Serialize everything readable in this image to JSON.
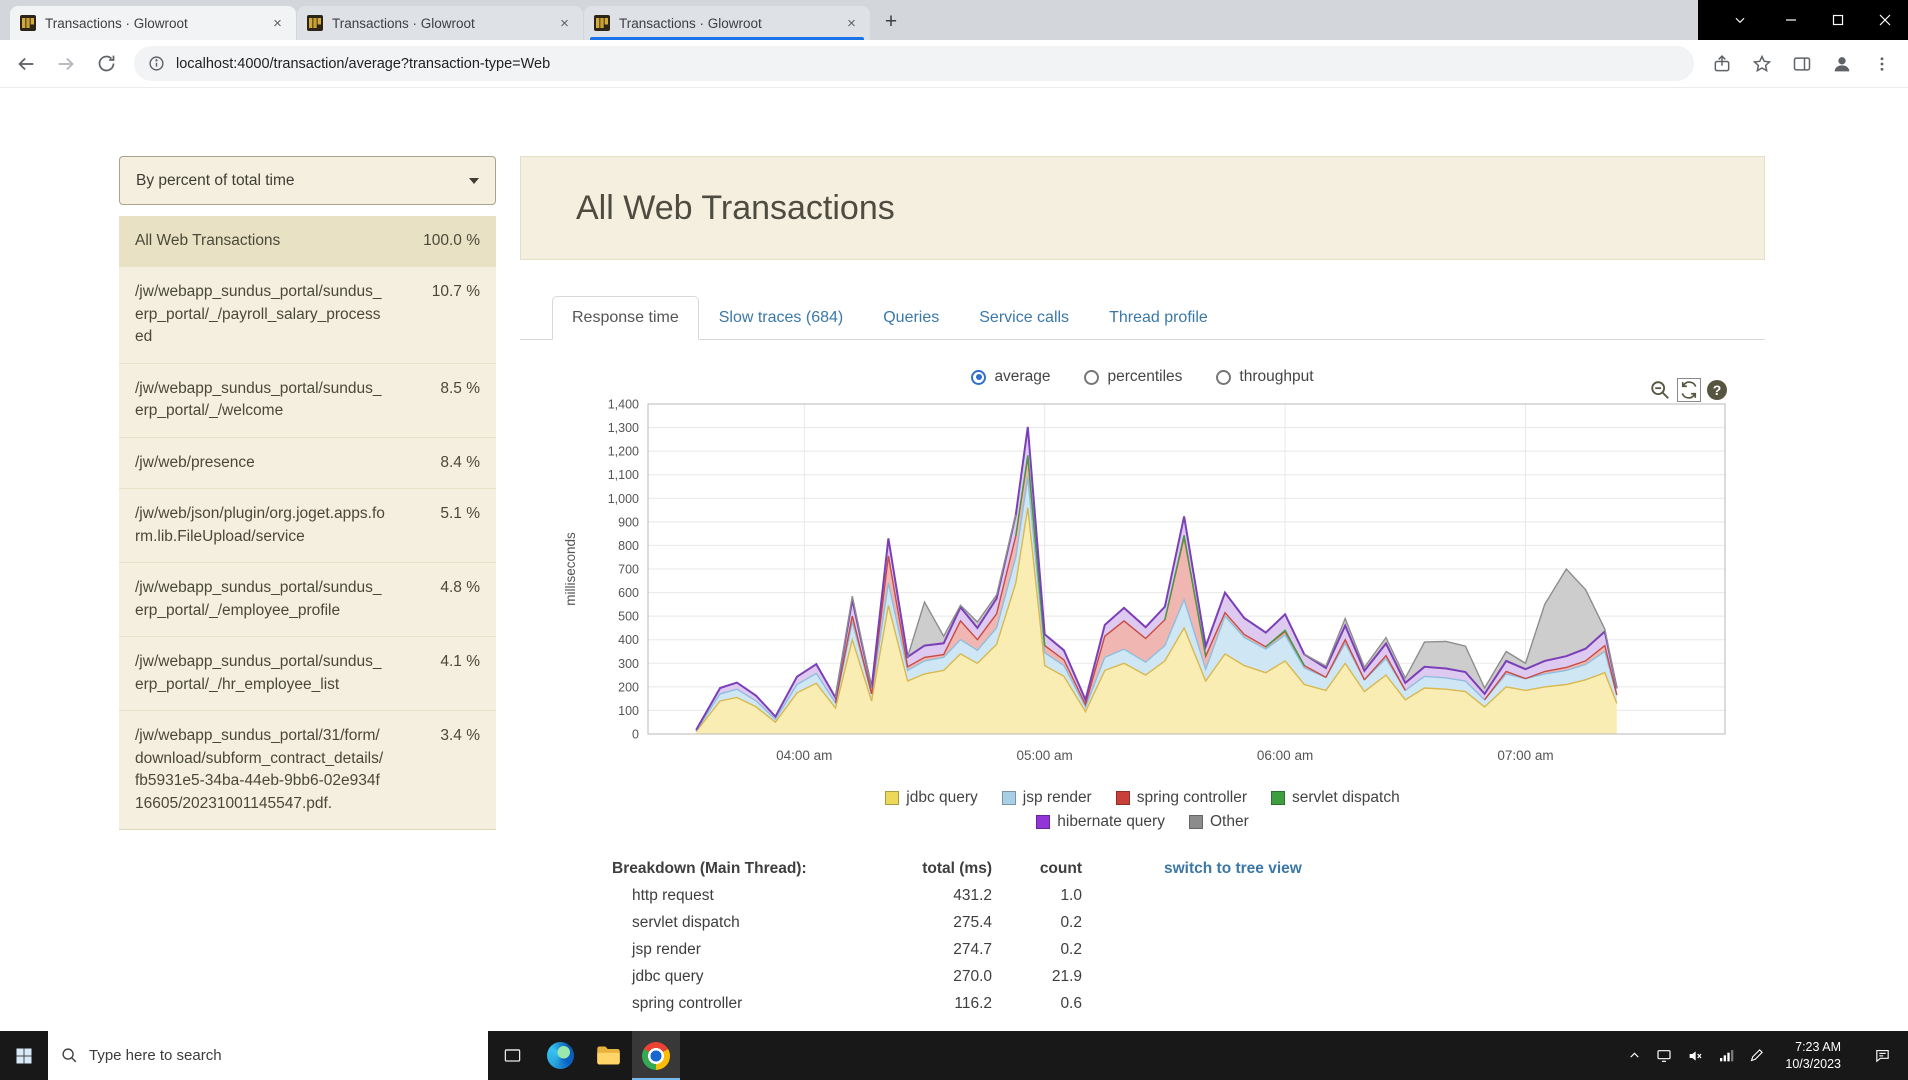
{
  "browser": {
    "tabs": [
      {
        "title": "Transactions · Glowroot"
      },
      {
        "title": "Transactions · Glowroot"
      },
      {
        "title": "Transactions · Glowroot"
      }
    ],
    "url": "localhost:4000/transaction/average?transaction-type=Web"
  },
  "sidebar": {
    "filter_label": "By percent of total time",
    "items": [
      {
        "label": "All Web Transactions",
        "percent": "100.0 %"
      },
      {
        "label": "/jw/webapp_sundus_portal/sundus_erp_portal/_/payroll_salary_processed",
        "percent": "10.7 %"
      },
      {
        "label": "/jw/webapp_sundus_portal/sundus_erp_portal/_/welcome",
        "percent": "8.5 %"
      },
      {
        "label": "/jw/web/presence",
        "percent": "8.4 %"
      },
      {
        "label": "/jw/web/json/plugin/org.joget.apps.form.lib.FileUpload/service",
        "percent": "5.1 %"
      },
      {
        "label": "/jw/webapp_sundus_portal/sundus_erp_portal/_/employee_profile",
        "percent": "4.8 %"
      },
      {
        "label": "/jw/webapp_sundus_portal/sundus_erp_portal/_/hr_employee_list",
        "percent": "4.1 %"
      },
      {
        "label": "/jw/webapp_sundus_portal/31/form/download/subform_contract_details/fb5931e5-34ba-44eb-9bb6-02e934f16605/20231001145547.pdf.",
        "percent": "3.4 %"
      }
    ]
  },
  "main": {
    "title": "All Web Transactions",
    "tabs": [
      {
        "label": "Response time"
      },
      {
        "label": "Slow traces (684)"
      },
      {
        "label": "Queries"
      },
      {
        "label": "Service calls"
      },
      {
        "label": "Thread profile"
      }
    ],
    "radios": [
      {
        "label": "average"
      },
      {
        "label": "percentiles"
      },
      {
        "label": "throughput"
      }
    ],
    "chart_data": {
      "type": "area",
      "stacked": true,
      "ylabel": "milliseconds",
      "ylim": [
        0,
        1400
      ],
      "y_tick_step": 100,
      "xlim_hours": [
        3.35,
        7.83
      ],
      "x_ticks": [
        {
          "hour": 4,
          "label": "04:00 am"
        },
        {
          "hour": 5,
          "label": "05:00 am"
        },
        {
          "hour": 6,
          "label": "06:00 am"
        },
        {
          "hour": 7,
          "label": "07:00 am"
        }
      ],
      "x_hours": [
        3.55,
        3.65,
        3.72,
        3.8,
        3.88,
        3.97,
        4.05,
        4.13,
        4.2,
        4.28,
        4.35,
        4.43,
        4.5,
        4.58,
        4.65,
        4.72,
        4.8,
        4.88,
        4.93,
        5.0,
        5.08,
        5.17,
        5.25,
        5.33,
        5.42,
        5.5,
        5.58,
        5.67,
        5.75,
        5.83,
        5.92,
        6.0,
        6.08,
        6.17,
        6.25,
        6.33,
        6.42,
        6.5,
        6.58,
        6.67,
        6.75,
        6.83,
        6.92,
        7.0,
        7.08,
        7.17,
        7.25,
        7.33,
        7.38
      ],
      "series": [
        {
          "name": "jdbc query",
          "fill": "#f9edb3",
          "line": "#d9b84e",
          "legend": "#eed859",
          "values": [
            10,
            140,
            155,
            115,
            50,
            175,
            215,
            110,
            400,
            140,
            545,
            225,
            255,
            270,
            340,
            300,
            380,
            640,
            960,
            290,
            245,
            95,
            270,
            300,
            250,
            310,
            450,
            225,
            340,
            290,
            260,
            310,
            210,
            185,
            300,
            180,
            250,
            145,
            195,
            190,
            180,
            115,
            200,
            185,
            200,
            210,
            230,
            260,
            130
          ]
        },
        {
          "name": "jsp render",
          "fill": "#cfe7f5",
          "line": "#8fbedc",
          "legend": "#a9cfe7",
          "values": [
            3,
            30,
            35,
            25,
            12,
            35,
            42,
            22,
            75,
            30,
            95,
            45,
            55,
            55,
            60,
            55,
            70,
            110,
            130,
            55,
            45,
            20,
            55,
            60,
            55,
            65,
            120,
            50,
            160,
            120,
            100,
            110,
            70,
            55,
            85,
            50,
            70,
            40,
            50,
            48,
            45,
            30,
            55,
            50,
            55,
            60,
            65,
            90,
            35
          ]
        },
        {
          "name": "spring controller",
          "fill": "#efb6b2",
          "line": "#c84b42",
          "legend": "#c9403a",
          "values": [
            0,
            0,
            0,
            0,
            0,
            0,
            0,
            0,
            25,
            0,
            115,
            15,
            15,
            12,
            80,
            45,
            60,
            90,
            85,
            30,
            25,
            10,
            90,
            120,
            100,
            110,
            265,
            55,
            15,
            12,
            10,
            15,
            10,
            0,
            15,
            0,
            12,
            0,
            0,
            0,
            0,
            0,
            10,
            0,
            10,
            12,
            15,
            25,
            0
          ]
        },
        {
          "name": "servlet dispatch",
          "fill": "#bcdcbc",
          "line": "#3f9e3f",
          "legend": "#3f9e3f",
          "values": [
            0,
            0,
            0,
            0,
            0,
            0,
            0,
            0,
            0,
            0,
            0,
            0,
            0,
            0,
            0,
            0,
            0,
            0,
            8,
            0,
            0,
            0,
            0,
            0,
            0,
            0,
            8,
            0,
            0,
            0,
            0,
            5,
            0,
            0,
            0,
            0,
            0,
            0,
            0,
            0,
            0,
            0,
            0,
            0,
            0,
            0,
            0,
            0,
            0
          ]
        },
        {
          "name": "hibernate query",
          "fill": "#dec9f0",
          "line": "#7b3fb8",
          "legend": "#9135d6",
          "values": [
            4,
            25,
            28,
            22,
            12,
            33,
            39,
            22,
            70,
            26,
            75,
            42,
            50,
            48,
            58,
            50,
            65,
            90,
            120,
            48,
            40,
            20,
            48,
            55,
            48,
            55,
            80,
            42,
            85,
            70,
            60,
            68,
            48,
            40,
            60,
            38,
            52,
            32,
            40,
            40,
            38,
            25,
            45,
            40,
            45,
            48,
            52,
            60,
            28
          ]
        },
        {
          "name": "Other",
          "fill": "#cdcdcd",
          "line": "#8d8d8d",
          "legend": "#8c8c8c",
          "values": [
            0,
            0,
            0,
            0,
            0,
            0,
            0,
            0,
            15,
            0,
            0,
            0,
            185,
            30,
            8,
            25,
            15,
            0,
            0,
            0,
            0,
            0,
            0,
            0,
            0,
            0,
            0,
            0,
            0,
            0,
            0,
            0,
            0,
            8,
            30,
            15,
            25,
            20,
            105,
            115,
            110,
            25,
            40,
            25,
            240,
            370,
            250,
            10,
            0
          ]
        }
      ]
    },
    "breakdown": {
      "title": "Breakdown (Main Thread):",
      "col_total": "total (ms)",
      "col_count": "count",
      "rows": [
        {
          "name": "http request",
          "total": "431.2",
          "count": "1.0"
        },
        {
          "name": "servlet dispatch",
          "total": "275.4",
          "count": "0.2"
        },
        {
          "name": "jsp render",
          "total": "274.7",
          "count": "0.2"
        },
        {
          "name": "jdbc query",
          "total": "270.0",
          "count": "21.9"
        },
        {
          "name": "spring controller",
          "total": "116.2",
          "count": "0.6"
        }
      ],
      "tree_link": "switch to tree view"
    }
  },
  "taskbar": {
    "search_placeholder": "Type here to search",
    "time": "7:23 AM",
    "date": "10/3/2023"
  }
}
